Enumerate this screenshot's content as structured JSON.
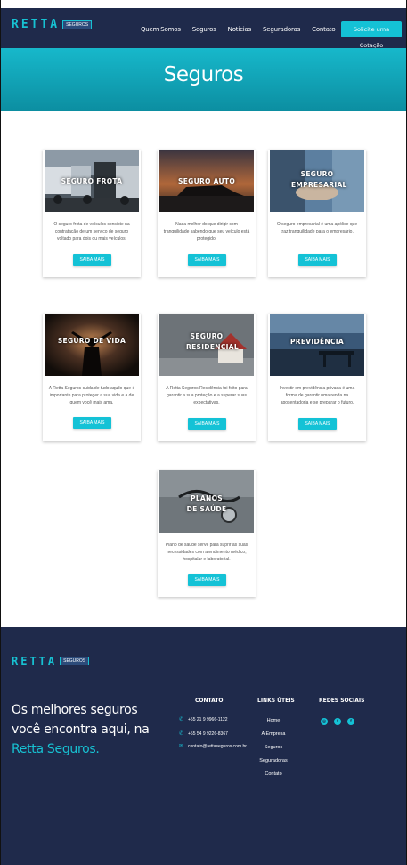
{
  "header": {
    "logo_text": "RETTA",
    "logo_tag": "SEGUROS",
    "menu": [
      "Quem Somos",
      "Seguros",
      "Notícias",
      "Seguradoras",
      "Contato"
    ],
    "cta_label": "Solicite uma Cotação"
  },
  "hero": {
    "title": "Seguros"
  },
  "cards": [
    {
      "title": "SEGURO FROTA",
      "description": "O seguro frota de veículos consiste na contratação de um serviço de seguro voltado para dois ou mais veículos.",
      "button": "SAIBA MAIS"
    },
    {
      "title": "SEGURO AUTO",
      "description": "Nada melhor do que dirigir com tranquilidade sabendo que seu veículo está protegido.",
      "button": "SAIBA MAIS"
    },
    {
      "title": "SEGURO EMPRESARIAL",
      "description": "O seguro empresarial é uma apólice que traz tranquilidade para o empresário.",
      "button": "SAIBA MAIS"
    },
    {
      "title": "SEGURO DE VIDA",
      "description": "A Retta Seguros cuida de tudo aquilo que é importante para proteger a sua vida e a de quem você mais ama.",
      "button": "SAIBA MAIS"
    },
    {
      "title": "SEGURO RESIDENCIAL",
      "description": "A Retta Seguros Residência foi feito para garantir a sua proteção e a superar suas expectativas.",
      "button": "SAIBA MAIS"
    },
    {
      "title": "PREVIDÊNCIA",
      "description": "Investir em previdência privada é uma forma de garantir uma renda na aposentadoria e se preparar o futuro.",
      "button": "SAIBA MAIS"
    },
    {
      "title": "PLANOS DE SAÚDE",
      "description": "Plano de saúde serve para suprir as suas necessidades com atendimento médico, hospitalar e laboratorial.",
      "button": "SAIBA MAIS"
    }
  ],
  "footer": {
    "logo_text": "RETTA",
    "logo_tag": "SEGUROS",
    "slogan_line1": "Os melhores seguros",
    "slogan_line2": "você encontra aqui, na",
    "slogan_highlight": "Retta Seguros.",
    "contact_heading": "CONTATO",
    "contact_phone1": "+55 21 9 9966-1122",
    "contact_phone2": "+55 54 9 9226-8367",
    "contact_email": "contato@rettaseguros.com.br",
    "links_heading": "LINKS ÚTEIS",
    "links": [
      "Home",
      "A Empresa",
      "Seguros",
      "Seguradoras",
      "Contato"
    ],
    "social_heading": "REDES SOCIAIS",
    "social": [
      "instagram-icon",
      "twitter-icon",
      "facebook-icon"
    ]
  },
  "colors": {
    "navy": "#1f2a4b",
    "accent": "#14c2d6"
  }
}
